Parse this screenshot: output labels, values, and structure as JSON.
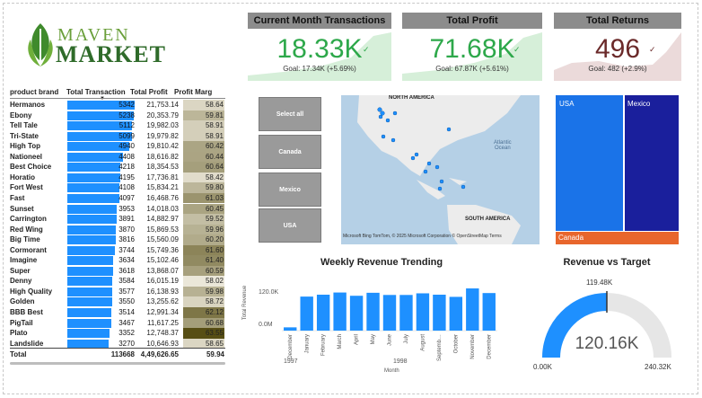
{
  "logo": {
    "word1": "MAVEN",
    "word2": "MARKET"
  },
  "table": {
    "headers": [
      "product brand",
      "Total Transaction",
      "Total Profit",
      "Profit Marg"
    ],
    "max_transactions": 5342,
    "rows": [
      {
        "brand": "Hermanos",
        "tx": 5342,
        "tx_label": "5342",
        "profit": "21,753.14",
        "margin": "58.64"
      },
      {
        "brand": "Ebony",
        "tx": 5238,
        "tx_label": "5238",
        "profit": "20,353.79",
        "margin": "59.81"
      },
      {
        "brand": "Tell Tale",
        "tx": 5112,
        "tx_label": "5112",
        "profit": "19,982.03",
        "margin": "58.91"
      },
      {
        "brand": "Tri-State",
        "tx": 5099,
        "tx_label": "5099",
        "profit": "19,979.82",
        "margin": "58.91"
      },
      {
        "brand": "High Top",
        "tx": 4940,
        "tx_label": "4940",
        "profit": "19,810.42",
        "margin": "60.42"
      },
      {
        "brand": "Nationeel",
        "tx": 4408,
        "tx_label": "4408",
        "profit": "18,616.82",
        "margin": "60.44"
      },
      {
        "brand": "Best Choice",
        "tx": 4218,
        "tx_label": "4218",
        "profit": "18,354.53",
        "margin": "60.64"
      },
      {
        "brand": "Horatio",
        "tx": 4195,
        "tx_label": "4195",
        "profit": "17,736.81",
        "margin": "58.42"
      },
      {
        "brand": "Fort West",
        "tx": 4108,
        "tx_label": "4108",
        "profit": "15,834.21",
        "margin": "59.80"
      },
      {
        "brand": "Fast",
        "tx": 4097,
        "tx_label": "4097",
        "profit": "16,468.76",
        "margin": "61.03"
      },
      {
        "brand": "Sunset",
        "tx": 3953,
        "tx_label": "3953",
        "profit": "14,018.03",
        "margin": "60.45"
      },
      {
        "brand": "Carrington",
        "tx": 3891,
        "tx_label": "3891",
        "profit": "14,882.97",
        "margin": "59.52"
      },
      {
        "brand": "Red Wing",
        "tx": 3870,
        "tx_label": "3870",
        "profit": "15,869.53",
        "margin": "59.96"
      },
      {
        "brand": "Big Time",
        "tx": 3816,
        "tx_label": "3816",
        "profit": "15,560.09",
        "margin": "60.20"
      },
      {
        "brand": "Cormorant",
        "tx": 3744,
        "tx_label": "3744",
        "profit": "15,749.36",
        "margin": "61.60"
      },
      {
        "brand": "Imagine",
        "tx": 3634,
        "tx_label": "3634",
        "profit": "15,102.46",
        "margin": "61.40"
      },
      {
        "brand": "Super",
        "tx": 3618,
        "tx_label": "3618",
        "profit": "13,868.07",
        "margin": "60.59"
      },
      {
        "brand": "Denny",
        "tx": 3584,
        "tx_label": "3584",
        "profit": "16,015.19",
        "margin": "58.02"
      },
      {
        "brand": "High Quality",
        "tx": 3577,
        "tx_label": "3577",
        "profit": "16,138.93",
        "margin": "59.98"
      },
      {
        "brand": "Golden",
        "tx": 3550,
        "tx_label": "3550",
        "profit": "13,255.62",
        "margin": "58.72"
      },
      {
        "brand": "BBB Best",
        "tx": 3514,
        "tx_label": "3514",
        "profit": "12,991.34",
        "margin": "62.12"
      },
      {
        "brand": "PigTail",
        "tx": 3467,
        "tx_label": "3467",
        "profit": "11,617.25",
        "margin": "60.68"
      },
      {
        "brand": "Plato",
        "tx": 3352,
        "tx_label": "3352",
        "profit": "12,748.37",
        "margin": "63.55"
      },
      {
        "brand": "Landslide",
        "tx": 3270,
        "tx_label": "3270",
        "profit": "10,646.93",
        "margin": "58.65"
      }
    ],
    "total": {
      "brand": "Total",
      "tx": "113668",
      "profit": "4,49,626.65",
      "margin": "59.94"
    }
  },
  "kpis": [
    {
      "title": "Current Month Transactions",
      "value": "18.33K",
      "goal": "Goal: 17.34K (+5.69%)",
      "color": "#2da84a",
      "bg": "#d6efd9"
    },
    {
      "title": "Total Profit",
      "value": "71.68K",
      "goal": "Goal: 67.87K (+5.61%)",
      "color": "#2da84a",
      "bg": "#d6efd9"
    },
    {
      "title": "Total Returns",
      "value": "496",
      "goal": "Goal: 482 (+2.9%)",
      "color": "#6b2a2a",
      "bg": "#ebdada"
    }
  ],
  "slicers": [
    "Select all",
    "Canada",
    "Mexico",
    "USA"
  ],
  "map": {
    "labels": {
      "na": "NORTH AMERICA",
      "ocean": "Atlantic\nOcean",
      "sa": "SOUTH AMERICA"
    },
    "attribution": "Microsoft Bing   TomTom, © 2025 Microsoft Corporation © OpenStreetMap  Terms"
  },
  "treemap": {
    "items": [
      {
        "label": "USA",
        "color": "#1a73e8"
      },
      {
        "label": "Mexico",
        "color": "#1a1f9c"
      },
      {
        "label": "Canada",
        "color": "#e8662c"
      }
    ]
  },
  "weekly": {
    "title": "Weekly Revenue Trending",
    "ylabel": "Total Revenue",
    "xlabel": "Month",
    "yticks": [
      "120.0K",
      "0.0M"
    ],
    "year_labels": [
      "1997",
      "1998"
    ]
  },
  "gauge": {
    "title": "Revenue vs Target",
    "value_label": "120.16K",
    "target_label": "119.48K",
    "min_label": "0.00K",
    "max_label": "240.32K",
    "value": 120.16,
    "max": 240.32,
    "color": "#1e90ff"
  },
  "chart_data": {
    "type": "bar",
    "title": "Weekly Revenue Trending",
    "xlabel": "Month",
    "ylabel": "Total Revenue",
    "categories": [
      "December",
      "January",
      "February",
      "March",
      "April",
      "May",
      "June",
      "July",
      "August",
      "September",
      "October",
      "November",
      "December"
    ],
    "values": [
      12,
      125,
      132,
      140,
      128,
      139,
      131,
      131,
      137,
      132,
      124,
      155,
      138
    ],
    "ylim": [
      0,
      165
    ],
    "color": "#1e90ff"
  }
}
